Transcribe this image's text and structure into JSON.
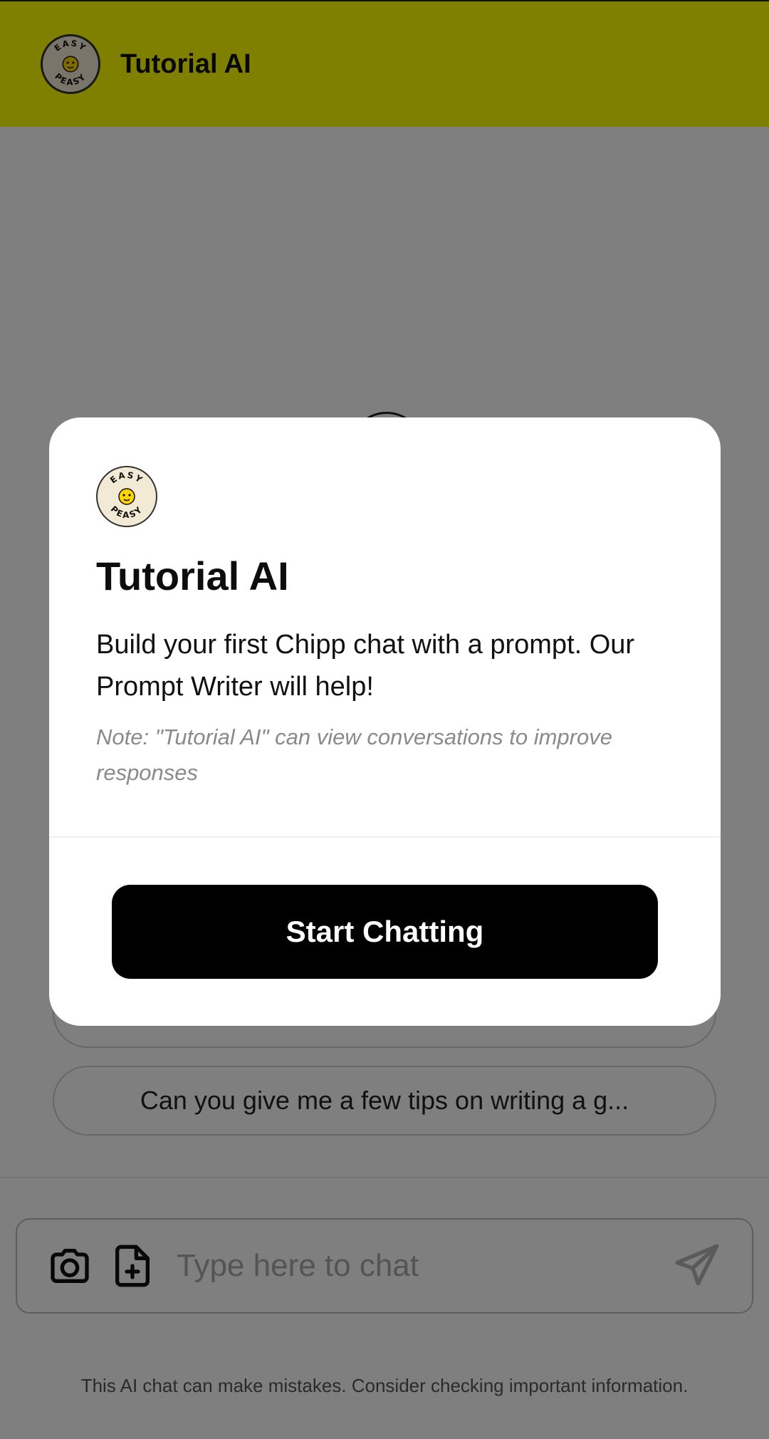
{
  "header": {
    "title": "Tutorial AI",
    "background_color": "#fffe00"
  },
  "suggestions": [
    {
      "text": ""
    },
    {
      "text": "Can you give me a few tips on writing a g..."
    }
  ],
  "composer": {
    "placeholder": "Type here to chat",
    "camera_icon": "camera-icon",
    "file_icon": "file-plus-icon",
    "send_icon": "send-icon"
  },
  "disclaimer": "This AI chat can make mistakes. Consider checking important information.",
  "modal": {
    "title": "Tutorial AI",
    "description": "Build your first Chipp chat with a prompt. Our Prompt Writer will help!",
    "note": "Note: \"Tutorial AI\" can view conversations to improve responses",
    "button_label": "Start Chatting"
  },
  "logo": {
    "top_text": "EASY",
    "bottom_text": "PEASY"
  }
}
